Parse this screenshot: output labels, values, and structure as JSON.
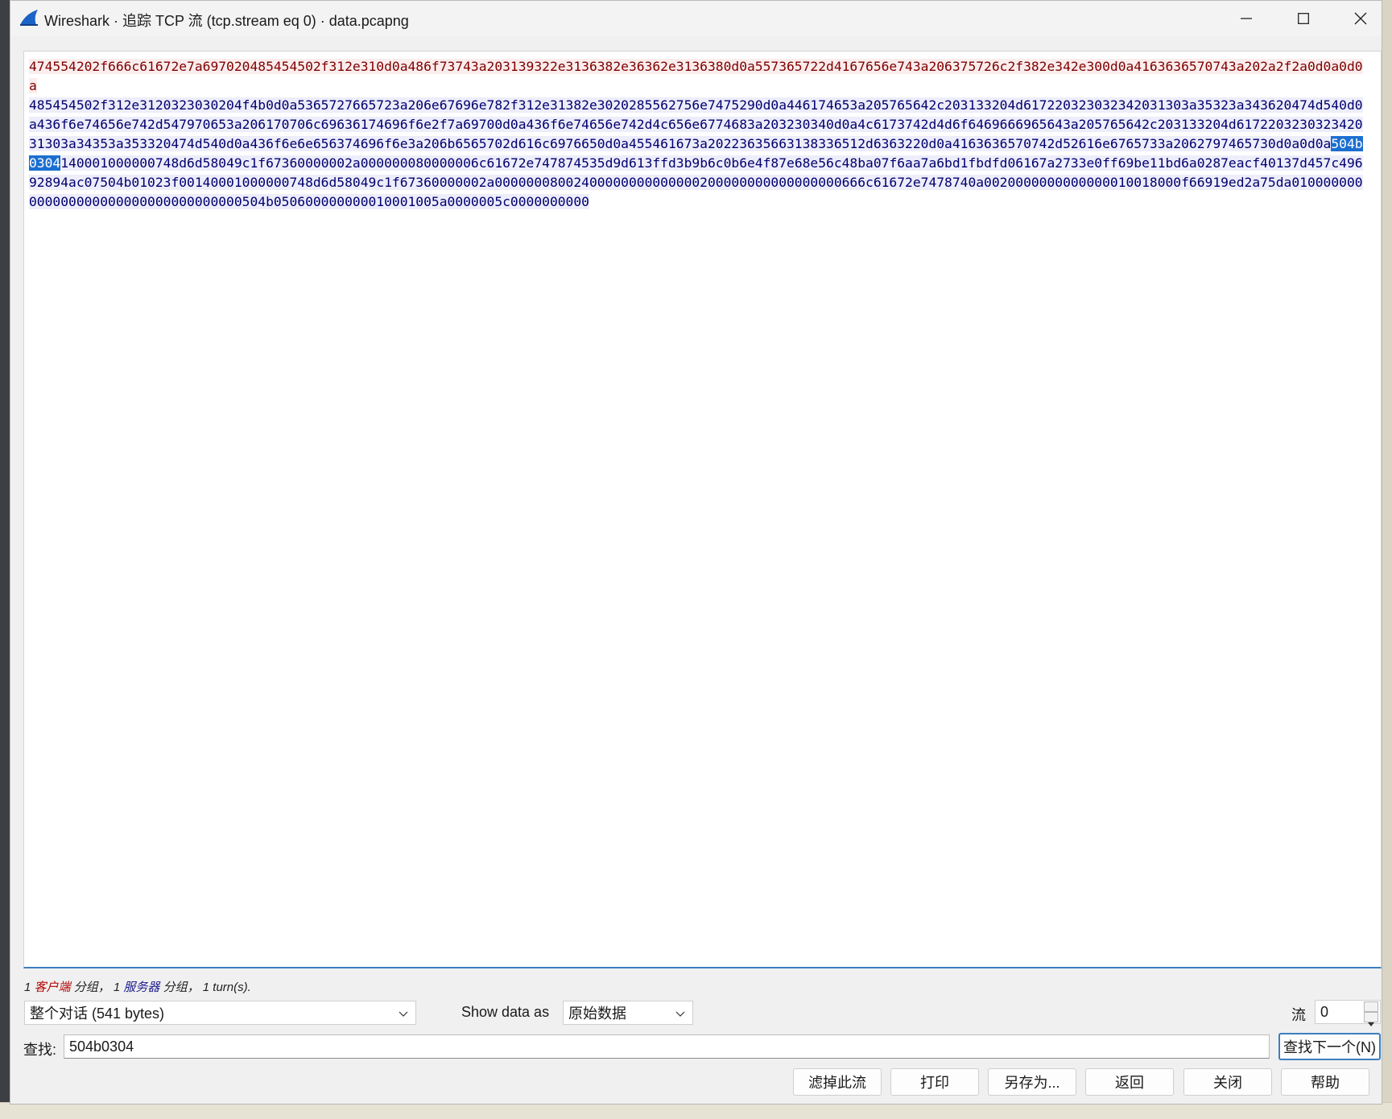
{
  "window": {
    "title": "Wireshark · 追踪 TCP 流 (tcp.stream eq 0) · data.pcapng"
  },
  "stream": {
    "client_text": "474554202f666c61672e7a697020485454502f312e310d0a486f73743a203139322e3136382e36362e3136380d0a557365722d4167656e743a206375726c2f382e342e300d0a4163636570743a202a2f2a0d0a0d0a",
    "server_before": "485454502f312e3120323030204f4b0d0a5365727665723a206e67696e782f312e31382e3020285562756e7475290d0a446174653a205765642c203133204d617220323032342031303a35323a343620474d540d0a436f6e74656e742d547970653a206170706c69636174696f6e2f7a69700d0a436f6e74656e742d4c656e6774683a203230340d0a4c6173742d4d6f6469666965643a205765642c203133204d617220323032342031303a34353a353320474d540d0a436f6e6e656374696f6e3a206b6565702d616c6976650d0a455461673a20223635663138336512d6363220d0a4163636570742d52616e6765733a2062797465730d0a0d0a",
    "server_highlight": "504b0304",
    "server_after": "140001000000748d6d58049c1f67360000002a000000080000006c61672e747874535d9d613ffd3b9b6c0b6e4f87e68e56c48ba07f6aa7a6bd1fbdfd06167a2733e0ff69be11bd6a0287eacf40137d457c49692894ac07504b01023f00140001000000748d6d58049c1f67360000002a00000008002400000000000000200000000000000000666c61672e7478740a0020000000000000010018000f66919ed2a75da010000000000000000000000000000000000504b050600000000010001005a0000005c0000000000"
  },
  "summary": {
    "client_count": "1",
    "client_word": "客户端",
    "sep1": "分组，",
    "server_count": "1",
    "server_word": "服务器",
    "sep2": "分组，",
    "turns": "1 turn(s)."
  },
  "controls": {
    "conversation": "整个对话 (541 bytes)",
    "show_data_label": "Show data as",
    "format": "原始数据",
    "stream_label": "流",
    "stream_value": "0",
    "find_label": "查找:",
    "find_value": "504b0304",
    "find_next": "查找下一个(N)"
  },
  "buttons": {
    "filter_out": "滤掉此流",
    "print": "打印",
    "save_as": "另存为...",
    "back": "返回",
    "close": "关闭",
    "help": "帮助"
  },
  "colors": {
    "client_fg": "#7f0000",
    "client_bg": "#fbeded",
    "server_fg": "#00006e",
    "server_bg": "#ededfb",
    "highlight": "#1c6fd1"
  }
}
